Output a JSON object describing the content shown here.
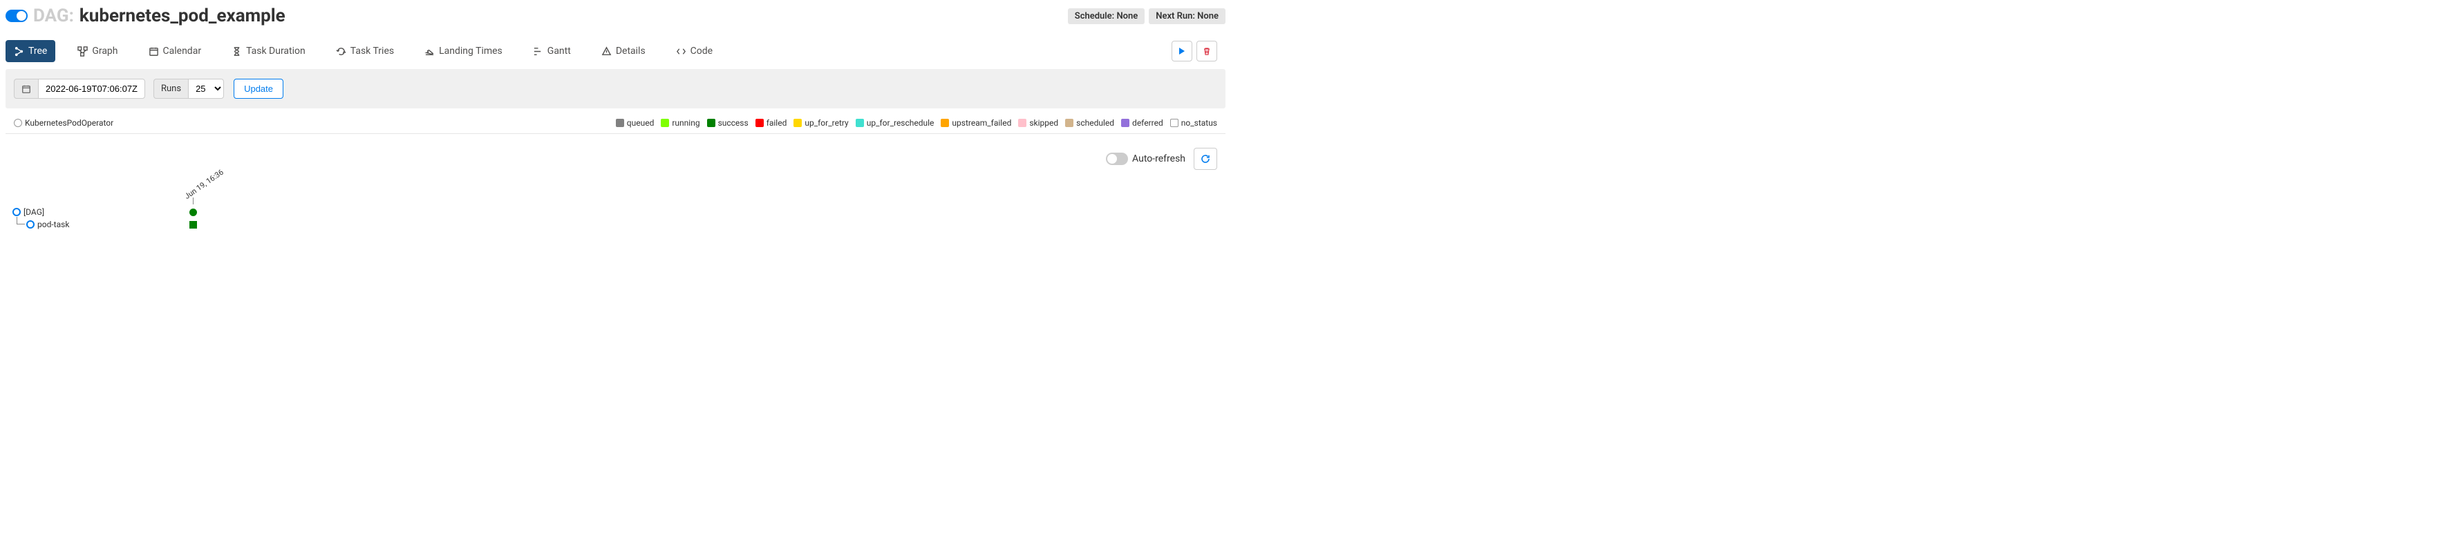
{
  "header": {
    "dag_label": "DAG:",
    "dag_name": "kubernetes_pod_example",
    "schedule": "Schedule: None",
    "next_run": "Next Run: None"
  },
  "tabs": {
    "tree": "Tree",
    "graph": "Graph",
    "calendar": "Calendar",
    "task_duration": "Task Duration",
    "task_tries": "Task Tries",
    "landing_times": "Landing Times",
    "gantt": "Gantt",
    "details": "Details",
    "code": "Code"
  },
  "filter": {
    "date": "2022-06-19T07:06:07Z",
    "runs_label": "Runs",
    "runs_value": "25",
    "update": "Update"
  },
  "operators": {
    "kpo": "KubernetesPodOperator"
  },
  "statuses": {
    "queued": {
      "label": "queued",
      "color": "#808080"
    },
    "running": {
      "label": "running",
      "color": "#7fff00"
    },
    "success": {
      "label": "success",
      "color": "#008000"
    },
    "failed": {
      "label": "failed",
      "color": "#ff0000"
    },
    "up_for_retry": {
      "label": "up_for_retry",
      "color": "#ffd700"
    },
    "up_for_reschedule": {
      "label": "up_for_reschedule",
      "color": "#40e0d0"
    },
    "upstream_failed": {
      "label": "upstream_failed",
      "color": "#ffa500"
    },
    "skipped": {
      "label": "skipped",
      "color": "#ffc0cb"
    },
    "scheduled": {
      "label": "scheduled",
      "color": "#d2b48c"
    },
    "deferred": {
      "label": "deferred",
      "color": "#9370db"
    },
    "no_status": {
      "label": "no_status",
      "color": "#ffffff"
    }
  },
  "controls": {
    "auto_refresh": "Auto-refresh"
  },
  "tree": {
    "dag_label": "[DAG]",
    "task1": "pod-task",
    "run_label": "Jun 19, 16:36",
    "run_color": "#008000"
  }
}
